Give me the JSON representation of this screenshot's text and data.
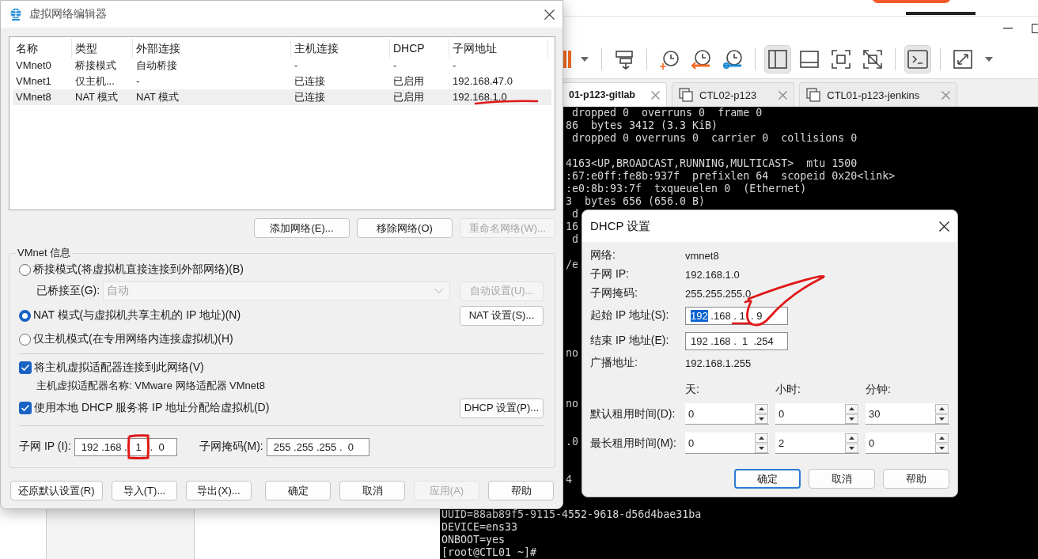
{
  "vmware": {
    "toolbar_buttons": [
      {
        "selected": false
      },
      {
        "selected": false
      },
      {
        "selected": false
      },
      {
        "selected": false
      },
      {
        "selected": true
      },
      {
        "selected": false
      },
      {
        "selected": false
      },
      {
        "selected": false
      },
      {
        "selected": true
      },
      {
        "selected": false
      }
    ],
    "tabs": [
      {
        "label": "01-p123-gitlab",
        "selected": true
      },
      {
        "label": "CTL02-p123",
        "selected": false
      },
      {
        "label": "CTL01-p123-jenkins",
        "selected": false
      }
    ],
    "terminal": {
      "partial_lines": [
        " dropped 0  overruns 0  frame 0",
        "86  bytes 3412 (3.3 KiB)",
        " dropped 0 overruns 0  carrier 0  collisions 0",
        "4163<UP,BROADCAST,RUNNING,MULTICAST>  mtu 1500",
        ":67:e0ff:fe8b:937f  prefixlen 64  scopeid 0x20<link>",
        ":e0:8b:93:7f  txqueuelen 0  (Ethernet)",
        "3  bytes 656 (656.0 B)",
        " d",
        "16",
        " d",
        "/e",
        "no",
        "no",
        ".0",
        "4"
      ],
      "lines": [
        "UUID=88ab89f5-9115-4552-9618-d56d4bae31ba",
        "DEVICE=ens33",
        "ONBOOT=yes",
        "[root@CTL01 ~]#"
      ]
    }
  },
  "editor": {
    "title": "虚拟网络编辑器",
    "columns": [
      "名称",
      "类型",
      "外部连接",
      "主机连接",
      "DHCP",
      "子网地址"
    ],
    "rows": [
      {
        "cells": [
          "VMnet0",
          "桥接模式",
          "自动桥接",
          "-",
          "-",
          "-"
        ],
        "selected": false
      },
      {
        "cells": [
          "VMnet1",
          "仅主机...",
          "-",
          "已连接",
          "已启用",
          "192.168.47.0"
        ],
        "selected": false
      },
      {
        "cells": [
          "VMnet8",
          "NAT 模式",
          "NAT 模式",
          "已连接",
          "已启用",
          "192.168.1.0"
        ],
        "selected": true,
        "underlined": true
      }
    ],
    "list_buttons": [
      {
        "label": "添加网络(E)...",
        "disabled": false
      },
      {
        "label": "移除网络(O)",
        "disabled": false
      },
      {
        "label": "重命名网络(W)...",
        "disabled": true
      }
    ],
    "group_title": "VMnet 信息",
    "modes": [
      {
        "label": "桥接模式(将虚拟机直接连接到外部网络)(B)",
        "selected": false
      },
      {
        "label": "NAT 模式(与虚拟机共享主机的 IP 地址)(N)",
        "selected": true
      },
      {
        "label": "仅主机模式(在专用网络内连接虚拟机)(H)",
        "selected": false
      }
    ],
    "bridge": {
      "label": "已桥接至(G):",
      "value": "自动",
      "disabled": true,
      "button": {
        "label": "自动设置(U)...",
        "disabled": true
      }
    },
    "nat_button": {
      "label": "NAT 设置(S)...",
      "disabled": false
    },
    "adapter_checkbox": {
      "label": "将主机虚拟适配器连接到此网络(V)",
      "checked": true
    },
    "adapter_name": "主机虚拟适配器名称: VMware 网络适配器 VMnet8",
    "dhcp_checkbox": {
      "label": "使用本地 DHCP 服务将 IP 地址分配给虚拟机(D)",
      "checked": true
    },
    "dhcp_button": {
      "label": "DHCP 设置(P)...",
      "disabled": false
    },
    "subnet_ip": {
      "label": "子网 IP (I):",
      "parts": [
        {
          "text": "192 .168 .   "
        },
        {
          "text": "1",
          "boxed": true
        },
        {
          "text": "   .  0"
        }
      ]
    },
    "subnet_mask": {
      "label": "子网掩码(M):",
      "parts": [
        {
          "text": "255 .255 .255 .  0"
        }
      ]
    },
    "footer_buttons": [
      {
        "label": "还原默认设置(R)",
        "disabled": false
      },
      {
        "label": "导入(T)...",
        "disabled": false
      },
      {
        "label": "导出(X)...",
        "disabled": false
      },
      {
        "label": "确定",
        "disabled": false
      },
      {
        "label": "取消",
        "disabled": false
      },
      {
        "label": "应用(A)",
        "disabled": true
      },
      {
        "label": "帮助",
        "disabled": false
      }
    ]
  },
  "dhcp": {
    "title": "DHCP 设置",
    "info": [
      {
        "label": "网络:",
        "value": "vmnet8"
      },
      {
        "label": "子网 IP:",
        "value": "192.168.1.0"
      },
      {
        "label": "子网掩码:",
        "value": "255.255.255.0"
      }
    ],
    "start_ip": {
      "label": "起始 IP 地址(S):",
      "parts": [
        {
          "text": "192",
          "selected": true
        },
        {
          "text": " .168 . ",
          "selected": false
        },
        {
          "text": "1",
          "selected": false,
          "underlined": true
        },
        {
          "text": "  . ",
          "selected": false
        },
        {
          "text": "9",
          "selected": false,
          "circled": true
        }
      ]
    },
    "end_ip": {
      "label": "结束 IP 地址(E):",
      "parts": [
        {
          "text": "192 .168 .  1  .254"
        }
      ]
    },
    "broadcast": {
      "label": "广播地址:",
      "value": "192.168.1.255"
    },
    "lease_headers": [
      "天:",
      "小时:",
      "分钟:"
    ],
    "leases": [
      {
        "label": "默认租用时间(D):",
        "values": [
          "0",
          "0",
          "30"
        ]
      },
      {
        "label": "最长租用时间(M):",
        "values": [
          "0",
          "2",
          "0"
        ]
      }
    ],
    "buttons": [
      {
        "label": "确定",
        "default": true
      },
      {
        "label": "取消",
        "default": false
      },
      {
        "label": "帮助",
        "default": false
      }
    ]
  }
}
